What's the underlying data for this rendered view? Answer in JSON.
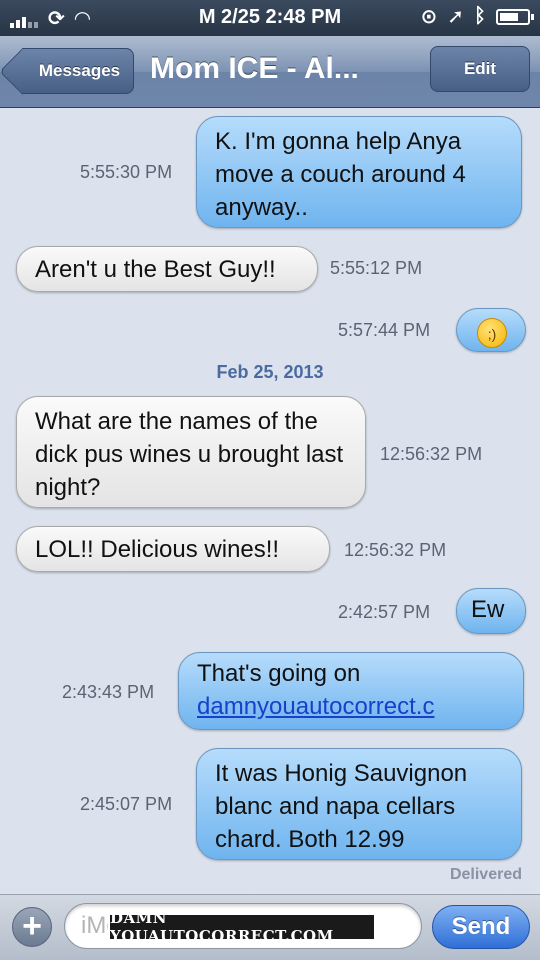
{
  "status_bar": {
    "carrier": "",
    "time": "M 2/25 2:48 PM"
  },
  "nav": {
    "back_label": "Messages",
    "title": "Mom ICE - Al...",
    "edit_label": "Edit"
  },
  "messages": [
    {
      "direction": "out",
      "text": "K. I'm gonna help Anya move a couch around 4 anyway..",
      "time": "5:55:30 PM"
    },
    {
      "direction": "in",
      "text": "Aren't u the Best Guy!!",
      "time": "5:55:12 PM"
    },
    {
      "direction": "out",
      "text": "😉",
      "time": "5:57:44 PM"
    },
    {
      "direction": "in",
      "text": "What are the names of the dick pus wines u brought last night?",
      "time": "12:56:32 PM"
    },
    {
      "direction": "in",
      "text": "LOL!!  Delicious wines!!",
      "time": "12:56:32 PM"
    },
    {
      "direction": "out",
      "text": "Ew",
      "time": "2:42:57 PM"
    },
    {
      "direction": "out",
      "text_prefix": "That's going on ",
      "link": "damnyouautocorrect.c",
      "time": "2:43:43 PM"
    },
    {
      "direction": "out",
      "text": "It was Honig Sauvignon blanc and napa cellars chard. Both 12.99",
      "time": "2:45:07 PM"
    }
  ],
  "date_separator": "Feb 25, 2013",
  "delivered_label": "Delivered",
  "composer": {
    "placeholder": "iMessage",
    "send_label": "Send",
    "watermark": "DAMN YOUAUTOCORRECT.COM"
  }
}
